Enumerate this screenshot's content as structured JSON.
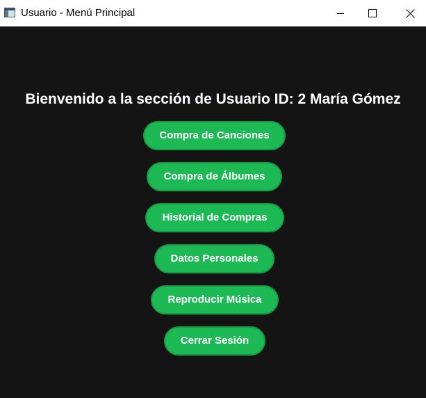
{
  "window": {
    "title": "Usuario - Menú Principal",
    "icon": "app-window-icon"
  },
  "controls": {
    "minimize_icon": "minimize-icon",
    "maximize_icon": "maximize-icon",
    "close_icon": "close-icon"
  },
  "main": {
    "heading": "Bienvenido a la sección de Usuario ID: 2 María Gómez",
    "buttons": [
      {
        "label": "Compra de Canciones"
      },
      {
        "label": "Compra de Álbumes"
      },
      {
        "label": "Historial de Compras"
      },
      {
        "label": "Datos Personales"
      },
      {
        "label": "Reproducir Música"
      },
      {
        "label": "Cerrar Sesión"
      }
    ]
  },
  "colors": {
    "background": "#141414",
    "accent": "#1db954",
    "text": "#ffffff"
  }
}
